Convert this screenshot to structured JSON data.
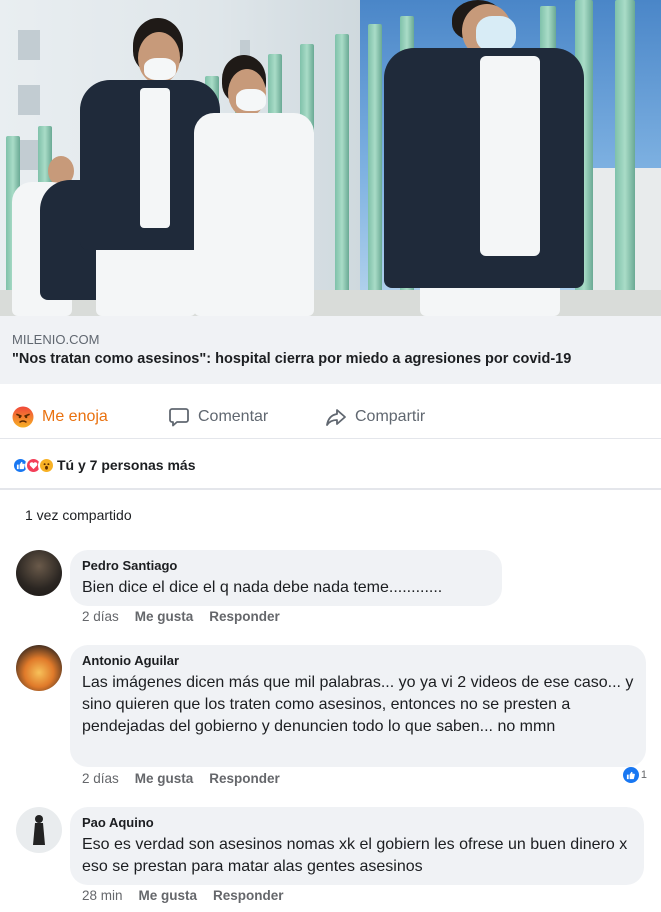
{
  "post": {
    "link": {
      "domain": "MILENIO.COM",
      "headline": "\"Nos tratan como asesinos\": hospital cierra por miedo a agresiones por covid-19"
    },
    "actions": {
      "reaction_label": "Me enoja",
      "comment_label": "Comentar",
      "share_label": "Compartir"
    },
    "reactions_text": "Tú y 7 personas más",
    "shares_text": "1 vez compartido",
    "colors": {
      "angry": "#e9710f",
      "like": "#1877f2",
      "love": "#f33e58",
      "wow": "#f7b125",
      "bubble": "#f0f2f5"
    }
  },
  "comments": [
    {
      "author": "Pedro Santiago",
      "text": "Bien dice el dice el q nada debe nada teme............",
      "time": "2 días",
      "like_label": "Me gusta",
      "reply_label": "Responder"
    },
    {
      "author": "Antonio Aguilar",
      "text": "Las imágenes dicen más que mil palabras... yo ya vi 2 videos de ese caso... y sino quieren que los traten como asesinos, entonces no se presten a pendejadas del gobierno y denuncien todo lo que saben... no mmn",
      "time": "2 días",
      "like_label": "Me gusta",
      "reply_label": "Responder",
      "like_count": "1"
    },
    {
      "author": "Pao Aquino",
      "text": "Eso es verdad son asesinos nomas xk el gobiern les ofrese un buen dinero x eso se prestan para matar alas gentes asesinos",
      "time": "28 min",
      "like_label": "Me gusta",
      "reply_label": "Responder"
    }
  ]
}
